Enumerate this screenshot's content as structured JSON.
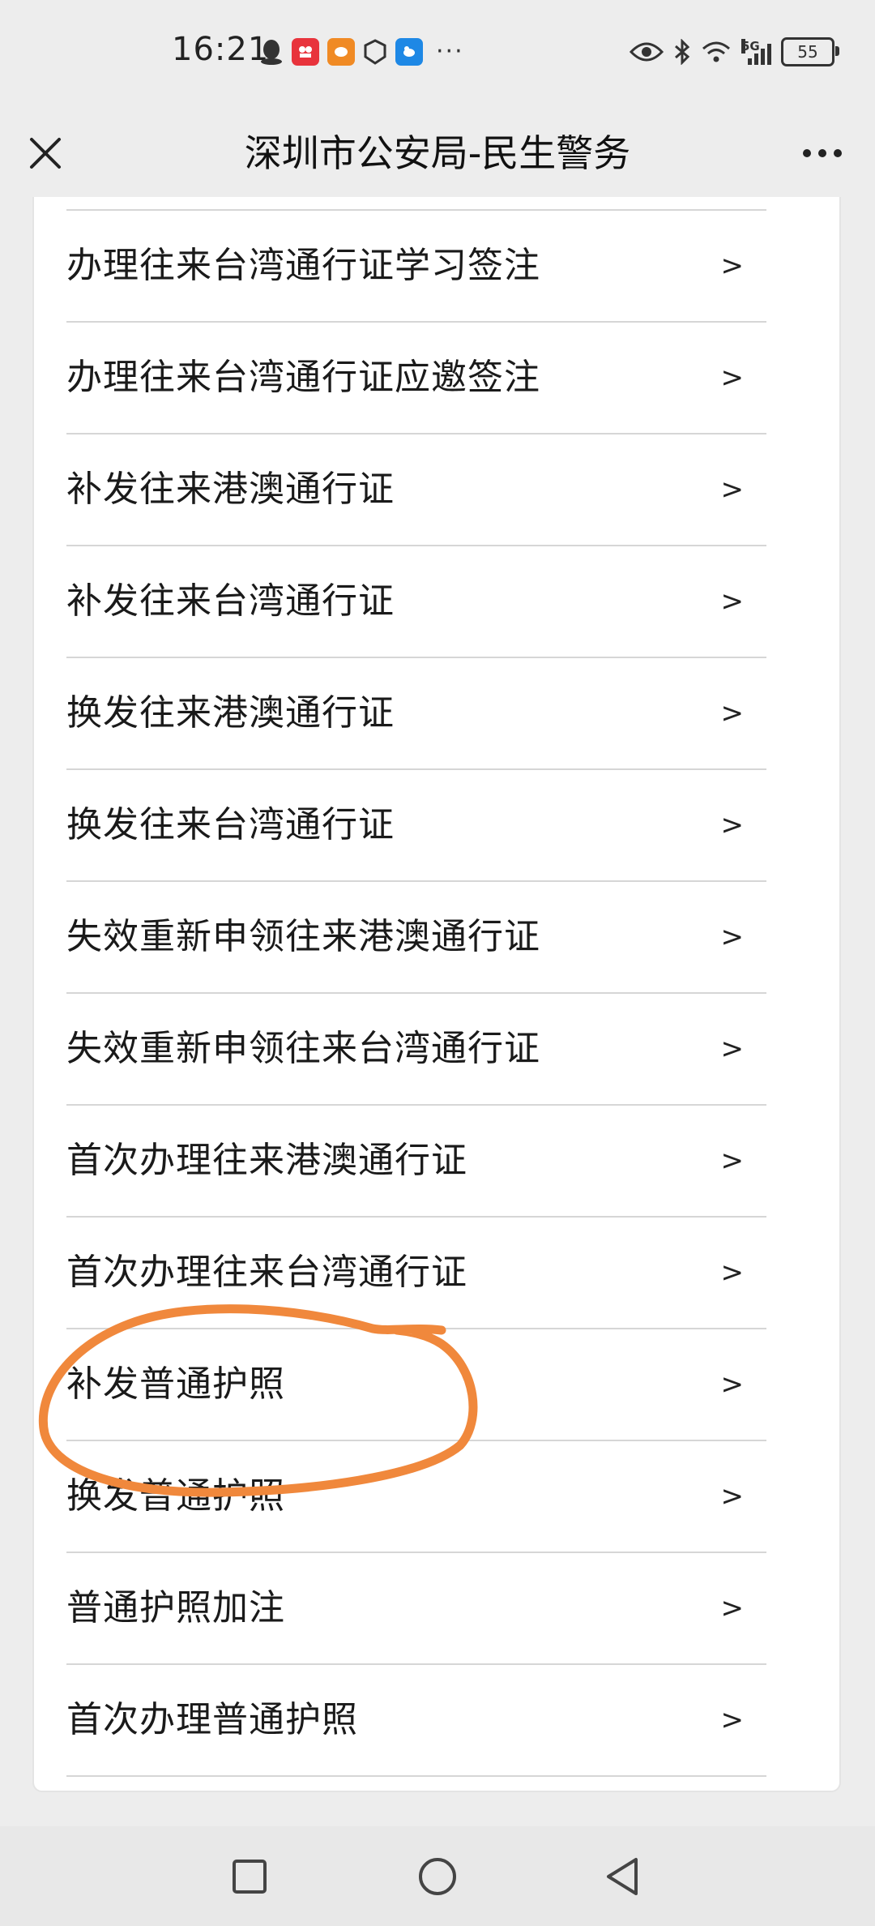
{
  "status_bar": {
    "time": "16:21",
    "network": "5G",
    "battery": "55",
    "app_icon_colors": [
      "#e8333c",
      "#f08a24",
      "#ffffff",
      "#1e88e5"
    ]
  },
  "nav": {
    "title": "深圳市公安局-民生警务"
  },
  "services": [
    {
      "label": "办理往来台湾通行证学习签注",
      "chevron": ">"
    },
    {
      "label": "办理往来台湾通行证应邀签注",
      "chevron": ">"
    },
    {
      "label": "补发往来港澳通行证",
      "chevron": ">"
    },
    {
      "label": "补发往来台湾通行证",
      "chevron": ">"
    },
    {
      "label": "换发往来港澳通行证",
      "chevron": ">"
    },
    {
      "label": "换发往来台湾通行证",
      "chevron": ">"
    },
    {
      "label": "失效重新申领往来港澳通行证",
      "chevron": ">"
    },
    {
      "label": "失效重新申领往来台湾通行证",
      "chevron": ">"
    },
    {
      "label": "首次办理往来港澳通行证",
      "chevron": ">"
    },
    {
      "label": "首次办理往来台湾通行证",
      "chevron": ">"
    },
    {
      "label": "补发普通护照",
      "chevron": ">"
    },
    {
      "label": "换发普通护照",
      "chevron": ">"
    },
    {
      "label": "普通护照加注",
      "chevron": ">"
    },
    {
      "label": "首次办理普通护照",
      "chevron": ">"
    }
  ],
  "annotation_color": "#f0883c",
  "icons": {
    "close": "close-icon",
    "more": "more-icon",
    "recents": "square-icon",
    "home": "circle-icon",
    "back": "triangle-back-icon"
  }
}
